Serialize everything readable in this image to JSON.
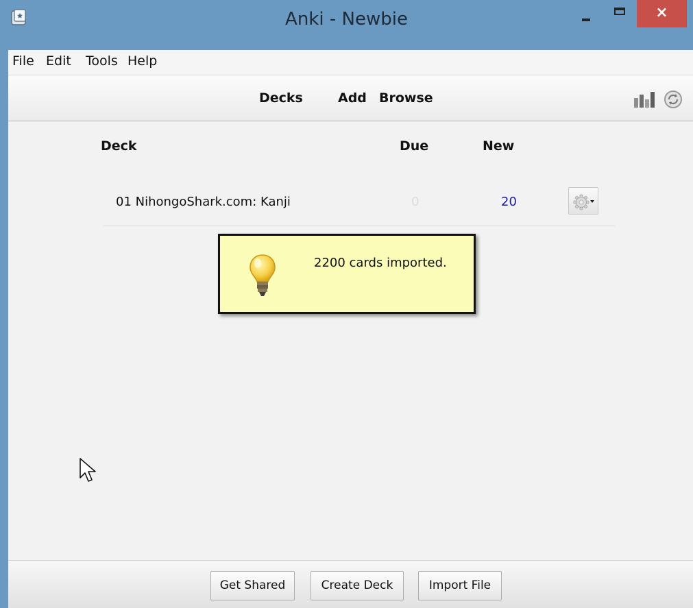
{
  "window": {
    "title": "Anki - Newbie",
    "close_glyph": "×"
  },
  "menu": {
    "items": [
      "File",
      "Edit",
      "Tools",
      "Help"
    ]
  },
  "toolbar": {
    "links": [
      "Decks",
      "Add",
      "Browse"
    ]
  },
  "deck_list": {
    "headers": {
      "deck": "Deck",
      "due": "Due",
      "new": "New"
    },
    "rows": [
      {
        "name": "01 NihongoShark.com: Kanji",
        "due": "0",
        "new": "20"
      }
    ]
  },
  "tooltip": {
    "message": "2200 cards imported."
  },
  "bottom_bar": {
    "buttons": [
      "Get Shared",
      "Create Deck",
      "Import File"
    ]
  },
  "icons": [
    "anki-app-icon",
    "minimize-icon",
    "maximize-icon",
    "close-icon",
    "stats-icon",
    "sync-icon",
    "gear-icon",
    "chevron-down-icon",
    "lightbulb-icon",
    "mouse-cursor-icon"
  ],
  "colors": {
    "titlebar": "#6a9ac2",
    "close_button": "#c7504a",
    "new_count": "#1a1aa0",
    "due_count": "#dcdcdc",
    "tooltip_bg": "#fbfcb8"
  }
}
